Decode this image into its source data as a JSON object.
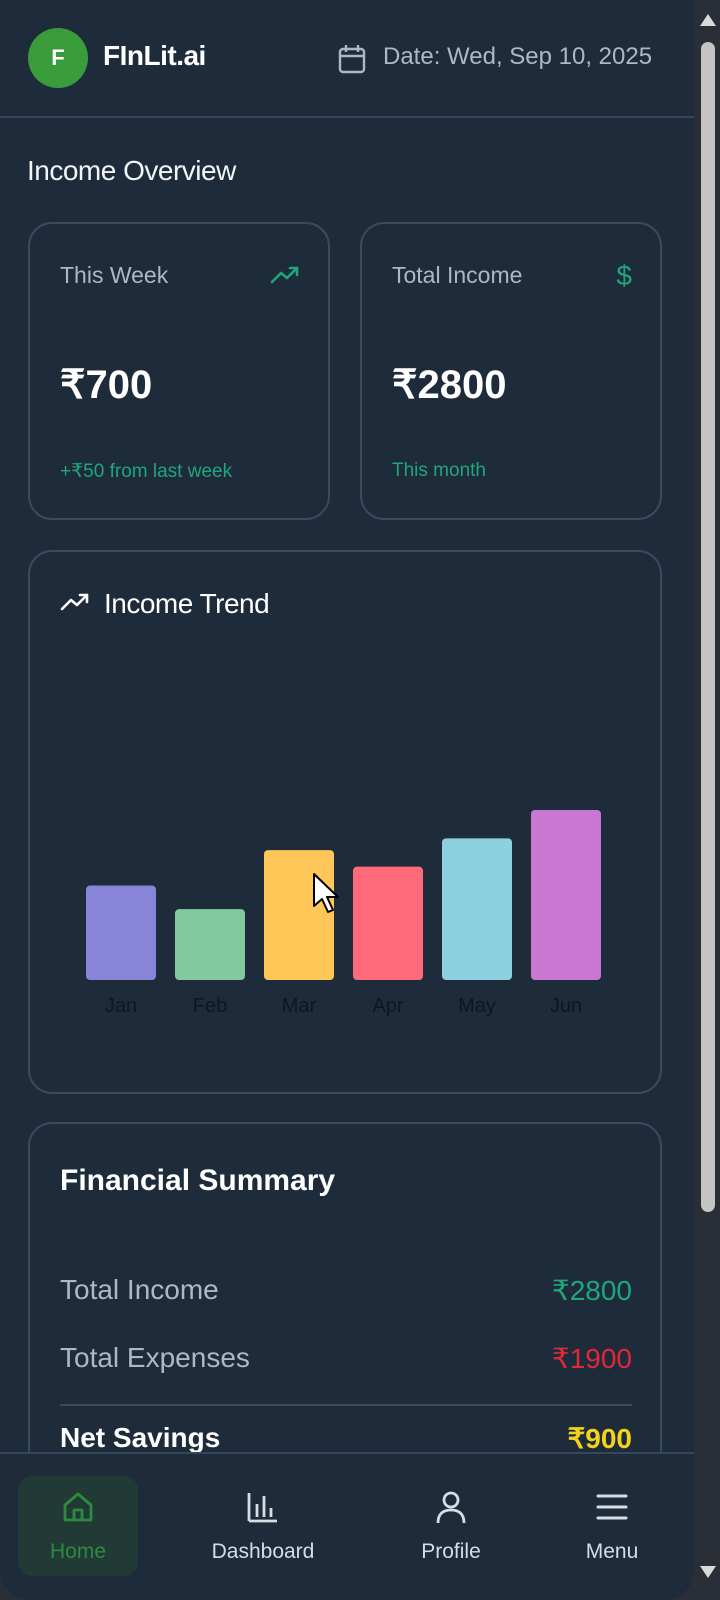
{
  "header": {
    "avatar_letter": "F",
    "brand": "FInLit.ai",
    "date": "Date: Wed, Sep 10, 2025"
  },
  "overview": {
    "title": "Income Overview",
    "cards": [
      {
        "label": "This Week",
        "icon": "trending-up-icon",
        "value": "₹700",
        "note": "+₹50 from last week"
      },
      {
        "label": "Total Income",
        "icon": "dollar-icon",
        "icon_glyph": "$",
        "value": "₹2800",
        "note": "This month"
      }
    ]
  },
  "trend": {
    "title": "Income Trend"
  },
  "chart_data": {
    "type": "bar",
    "categories": [
      "Jan",
      "Feb",
      "Mar",
      "Apr",
      "May",
      "Jun"
    ],
    "values": [
      400,
      300,
      550,
      480,
      600,
      720
    ],
    "colors": [
      "#8884d8",
      "#82ca9d",
      "#ffc658",
      "#ff6b7a",
      "#8dd1e1",
      "#c878d0"
    ],
    "title": "",
    "xlabel": "",
    "ylabel": "",
    "ylim": [
      0,
      720
    ],
    "grid": false
  },
  "summary": {
    "title": "Financial Summary",
    "income_label": "Total Income",
    "income_value": "₹2800",
    "expenses_label": "Total Expenses",
    "expenses_value": "₹1900",
    "savings_label": "Net Savings",
    "savings_value": "₹900"
  },
  "colors": {
    "accent_green": "#1fa67a",
    "expense_red": "#e0283b",
    "savings_yellow": "#f2d21b",
    "nav_active": "#2e8a3f"
  },
  "nav": [
    {
      "label": "Home",
      "icon": "home-icon",
      "active": true
    },
    {
      "label": "Dashboard",
      "icon": "bar-chart-icon",
      "active": false
    },
    {
      "label": "Profile",
      "icon": "user-icon",
      "active": false
    },
    {
      "label": "Menu",
      "icon": "menu-icon",
      "active": false
    }
  ]
}
